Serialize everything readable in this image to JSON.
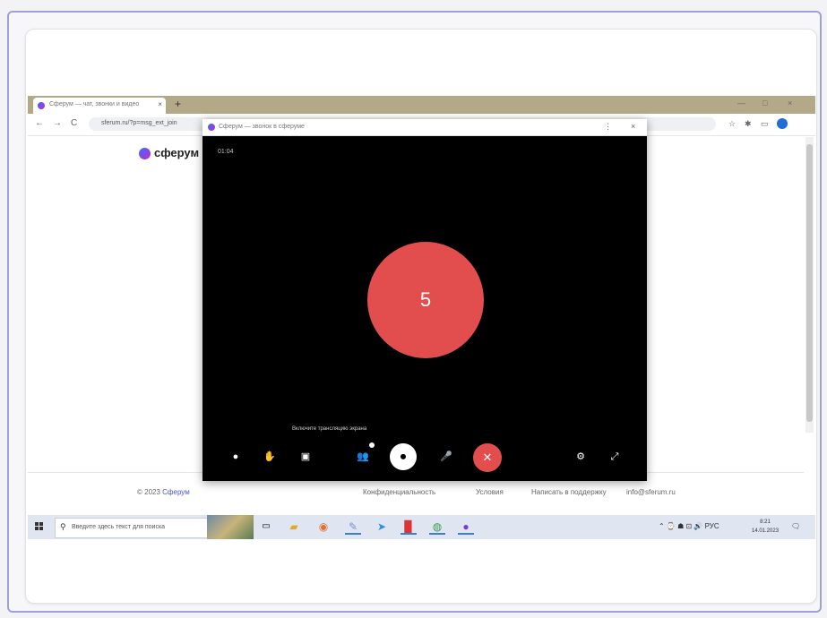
{
  "browser": {
    "tab_title": "Сферум — чат, звонки и видео",
    "tab_close": "×",
    "new_tab": "+",
    "url": "sferum.ru/?p=msg_ext_join",
    "window_controls": [
      "—",
      "□",
      "×"
    ],
    "nav": [
      "←",
      "→",
      "C"
    ]
  },
  "site": {
    "logo_text": "сферум",
    "footer_copy": "© 2023 ",
    "footer_brand": "Сферум",
    "footer_links": [
      "Конфиденциальность",
      "Условия",
      "Написать в поддержку"
    ],
    "footer_email": "info@sferum.ru"
  },
  "popup": {
    "title": "Сферум — звонок в сферуме",
    "controls": [
      "⋮",
      "×"
    ],
    "timer": "01:04",
    "participant_number": "5",
    "tooltip": "Включите трансляцию экрана",
    "buttons": {
      "chat": "●",
      "raise_hand": "✋",
      "screen": "▣",
      "participants": "👥",
      "camera": "⏺",
      "mic": "🎤",
      "end_call": "✕",
      "settings": "⚙",
      "fullscreen": "⤢"
    }
  },
  "taskbar": {
    "search_placeholder": "Введите здесь текст для поиска",
    "tray_text": "⌃ ⌚ ☗ ⊡ 🔊 РУС",
    "clock_time": "8:21",
    "clock_date": "14.01.2023"
  },
  "colors": {
    "frame": "#9fa0d8",
    "end_call": "#e24e4e",
    "brand": "#4a56c8"
  }
}
